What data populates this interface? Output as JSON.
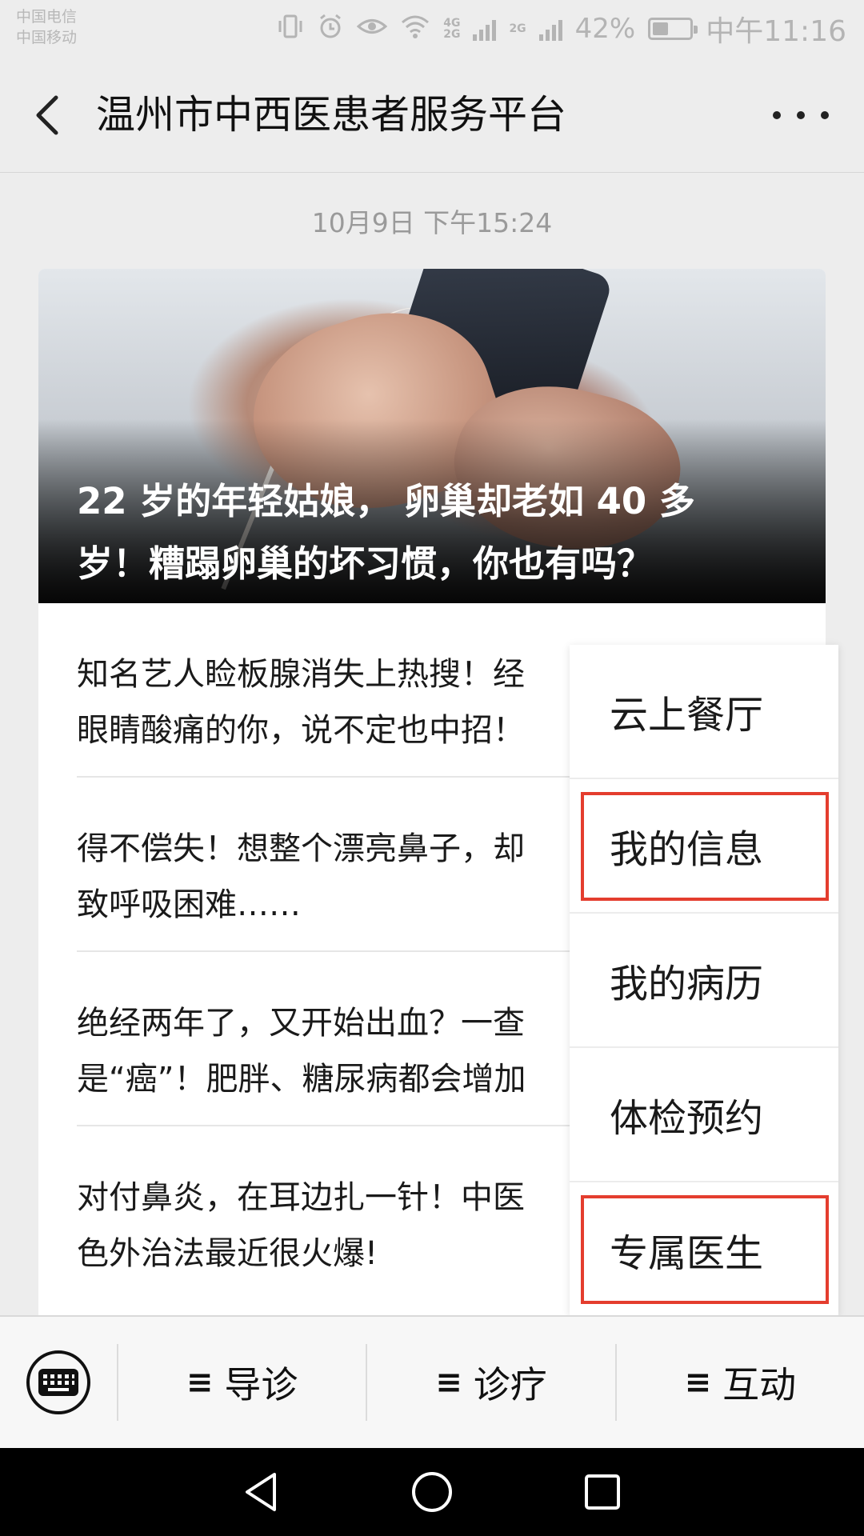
{
  "status_bar": {
    "carriers": [
      "中国电信",
      "中国移动"
    ],
    "network": "4G",
    "network_sub": "2G",
    "network2": "2G",
    "battery_percent_text": "42%",
    "battery_level": 0.42,
    "time": "中午11:16"
  },
  "header": {
    "title": "温州市中西医患者服务平台",
    "back_icon": "chevron-left-icon",
    "more_icon": "more-dots-icon"
  },
  "chat": {
    "timestamp": "10月9日 下午15:24",
    "article": {
      "cover_title_line1": "22 岁的年轻姑娘， 卵巢却老如 40 多",
      "cover_title_line2": "岁！糟蹋卵巢的坏习惯，你也有吗？",
      "items": [
        {
          "line1": "知名艺人睑板腺消失上热搜！经",
          "line2": "眼睛酸痛的你，说不定也中招！"
        },
        {
          "line1": "得不偿失！想整个漂亮鼻子，却",
          "line2": "致呼吸困难……"
        },
        {
          "line1": "绝经两年了，又开始出血？一查",
          "line2": "是“癌”！肥胖、糖尿病都会增加"
        },
        {
          "line1": "对付鼻炎，在耳边扎一针！中医",
          "line2": "色外治法最近很火爆!"
        }
      ]
    }
  },
  "popup_menu": {
    "items": [
      {
        "label": "云上餐厅",
        "highlighted": false
      },
      {
        "label": "我的信息",
        "highlighted": true
      },
      {
        "label": "我的病历",
        "highlighted": false
      },
      {
        "label": "体检预约",
        "highlighted": false
      },
      {
        "label": "专属医生",
        "highlighted": true
      }
    ],
    "highlight_color": "#e43d2e"
  },
  "menu_bar": {
    "keyboard_icon": "keyboard-icon",
    "tabs": [
      {
        "icon": "≡",
        "label": "导诊"
      },
      {
        "icon": "≡",
        "label": "诊疗"
      },
      {
        "icon": "≡",
        "label": "互动"
      }
    ]
  },
  "nav_bar": {
    "icons": [
      "nav-back-icon",
      "nav-home-icon",
      "nav-recents-icon"
    ]
  }
}
